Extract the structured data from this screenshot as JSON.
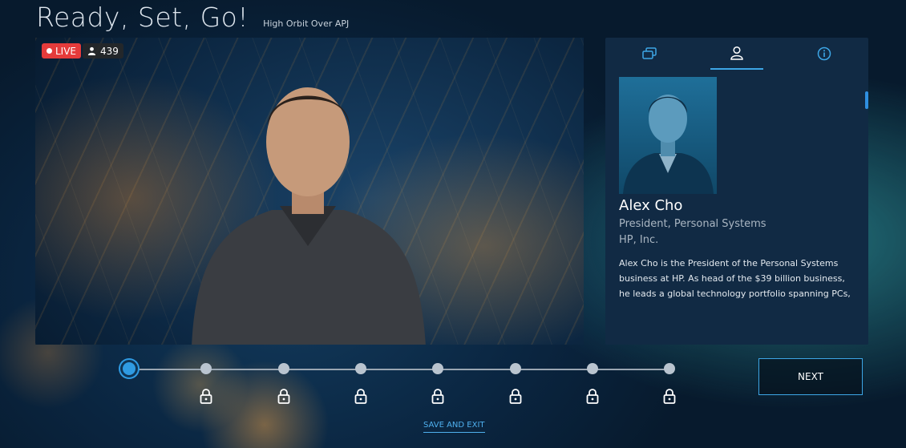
{
  "header": {
    "title": "Ready, Set, Go!",
    "subtitle": "High Orbit Over APJ"
  },
  "video": {
    "live_label": "LIVE",
    "viewer_count": "439"
  },
  "panel": {
    "tabs": [
      {
        "icon": "chat-icon",
        "active": false
      },
      {
        "icon": "person-icon",
        "active": true
      },
      {
        "icon": "info-icon",
        "active": false
      }
    ],
    "profile": {
      "name": "Alex Cho",
      "role": "President, Personal Systems",
      "company": "HP, Inc.",
      "bio": "Alex Cho is the President of the Personal Systems business at HP. As head of the $39 billion business, he leads a global technology portfolio spanning PCs, displays and accessories, services, software, and"
    }
  },
  "progress": {
    "total_steps": 8,
    "current_step": 1,
    "locked_steps": [
      2,
      3,
      4,
      5,
      6,
      7,
      8
    ]
  },
  "actions": {
    "next_label": "NEXT",
    "save_exit_label": "SAVE AND EXIT"
  },
  "colors": {
    "accent": "#3da6e6",
    "live": "#e53b3b",
    "panel_bg": "#112a44"
  }
}
